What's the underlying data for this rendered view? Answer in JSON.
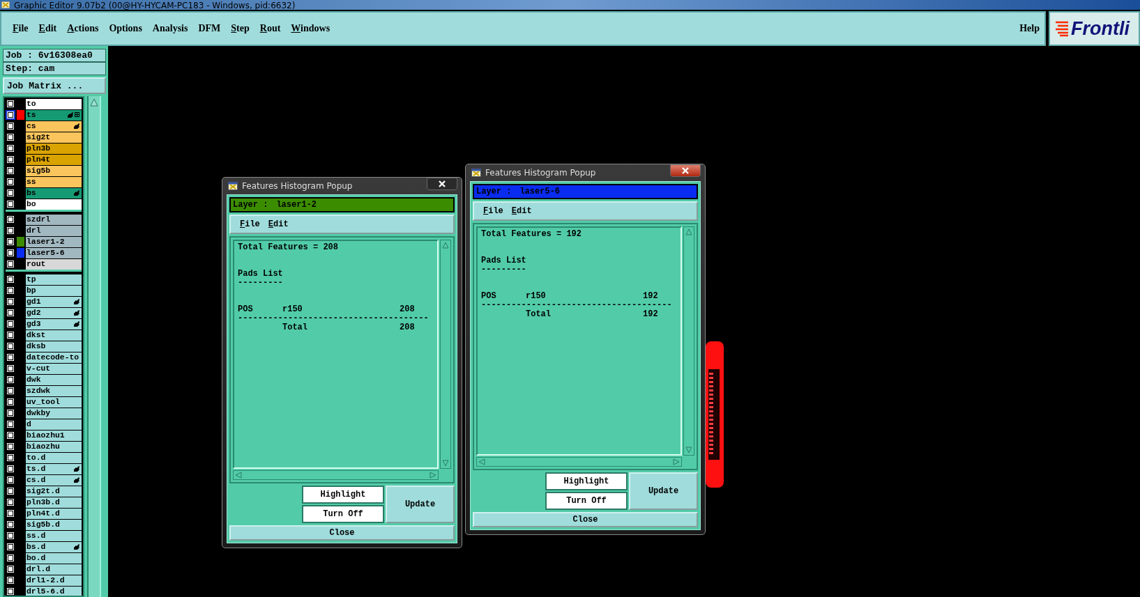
{
  "window": {
    "title": "Graphic Editor 9.07b2 (00@HY-HYCAM-PC183 - Windows, pid:6632)"
  },
  "menu": [
    {
      "label": "File",
      "mnemonic": true
    },
    {
      "label": "Edit",
      "mnemonic": true
    },
    {
      "label": "Actions",
      "mnemonic": true
    },
    {
      "label": "Options",
      "mnemonic": false
    },
    {
      "label": "Analysis",
      "mnemonic": false
    },
    {
      "label": "DFM",
      "mnemonic": false
    },
    {
      "label": "Step",
      "mnemonic": true
    },
    {
      "label": "Rout",
      "mnemonic": true
    },
    {
      "label": "Windows",
      "mnemonic": true
    }
  ],
  "help": "Help",
  "logo": "Frontli",
  "job": "Job : 6v16308ea0",
  "step": "Step: cam",
  "job_matrix": "Job Matrix ...",
  "layer_groups": [
    {
      "layers": [
        {
          "name": "to",
          "color": "#ffffff",
          "selected": false,
          "affected": false
        },
        {
          "name": "ts",
          "color": "#169a74",
          "swatch": {
            "color": "#ff0000"
          },
          "selected": true,
          "affected": true
        },
        {
          "name": "cs",
          "color": "#fac55c",
          "selected": false,
          "affected": true
        },
        {
          "name": "sig2t",
          "color": "#fac55c",
          "selected": false,
          "affected": false
        },
        {
          "name": "pln3b",
          "color": "#d9a300",
          "selected": false,
          "affected": false
        },
        {
          "name": "pln4t",
          "color": "#d9a300",
          "selected": false,
          "affected": false
        },
        {
          "name": "sig5b",
          "color": "#fac55c",
          "selected": false,
          "affected": false
        },
        {
          "name": "ss",
          "color": "#fac55c",
          "selected": false,
          "affected": false
        },
        {
          "name": "bs",
          "color": "#169a74",
          "selected": false,
          "affected": true
        },
        {
          "name": "bo",
          "color": "#ffffff",
          "selected": false,
          "affected": false
        }
      ]
    },
    {
      "layers": [
        {
          "name": "szdrl",
          "color": "#a2b8c0",
          "selected": false,
          "affected": false
        },
        {
          "name": "drl",
          "color": "#a2b8c0",
          "selected": false,
          "affected": false
        },
        {
          "name": "laser1-2",
          "color": "#a2b8c0",
          "swatch": {
            "color": "#3c8c00"
          },
          "selected": false,
          "affected": false
        },
        {
          "name": "laser5-6",
          "color": "#a2b8c0",
          "swatch": {
            "color": "#0a2cf0"
          },
          "selected": false,
          "affected": false
        },
        {
          "name": "rout",
          "color": "#d8d8d8",
          "selected": false,
          "affected": false
        }
      ]
    },
    {
      "layers": [
        {
          "name": "tp",
          "color": "#a0dcdc",
          "selected": false,
          "affected": false
        },
        {
          "name": "bp",
          "color": "#a0dcdc",
          "selected": false,
          "affected": false
        },
        {
          "name": "gd1",
          "color": "#a0dcdc",
          "selected": false,
          "affected": true
        },
        {
          "name": "gd2",
          "color": "#a0dcdc",
          "selected": false,
          "affected": true
        },
        {
          "name": "gd3",
          "color": "#a0dcdc",
          "selected": false,
          "affected": true
        },
        {
          "name": "dkst",
          "color": "#a0dcdc",
          "selected": false,
          "affected": false
        },
        {
          "name": "dksb",
          "color": "#a0dcdc",
          "selected": false,
          "affected": false
        },
        {
          "name": "datecode-to",
          "color": "#a0dcdc",
          "selected": false,
          "affected": false
        },
        {
          "name": "v-cut",
          "color": "#a0dcdc",
          "selected": false,
          "affected": false
        },
        {
          "name": "dwk",
          "color": "#a0dcdc",
          "selected": false,
          "affected": false
        },
        {
          "name": "szdwk",
          "color": "#a0dcdc",
          "selected": false,
          "affected": false
        },
        {
          "name": "uv_tool",
          "color": "#a0dcdc",
          "selected": false,
          "affected": false
        },
        {
          "name": "dwkby",
          "color": "#a0dcdc",
          "selected": false,
          "affected": false
        },
        {
          "name": "d",
          "color": "#a0dcdc",
          "selected": false,
          "affected": false
        },
        {
          "name": "biaozhu1",
          "color": "#a0dcdc",
          "selected": false,
          "affected": false
        },
        {
          "name": "biaozhu",
          "color": "#a0dcdc",
          "selected": false,
          "affected": false
        },
        {
          "name": "to.d",
          "color": "#a0dcdc",
          "selected": false,
          "affected": false
        },
        {
          "name": "ts.d",
          "color": "#a0dcdc",
          "selected": false,
          "affected": true
        },
        {
          "name": "cs.d",
          "color": "#a0dcdc",
          "selected": false,
          "affected": true
        },
        {
          "name": "sig2t.d",
          "color": "#a0dcdc",
          "selected": false,
          "affected": false
        },
        {
          "name": "pln3b.d",
          "color": "#a0dcdc",
          "selected": false,
          "affected": false
        },
        {
          "name": "pln4t.d",
          "color": "#a0dcdc",
          "selected": false,
          "affected": false
        },
        {
          "name": "sig5b.d",
          "color": "#a0dcdc",
          "selected": false,
          "affected": false
        },
        {
          "name": "ss.d",
          "color": "#a0dcdc",
          "selected": false,
          "affected": false
        },
        {
          "name": "bs.d",
          "color": "#a0dcdc",
          "selected": false,
          "affected": true
        },
        {
          "name": "bo.d",
          "color": "#a0dcdc",
          "selected": false,
          "affected": false
        },
        {
          "name": "drl.d",
          "color": "#a0dcdc",
          "selected": false,
          "affected": false
        },
        {
          "name": "drl1-2.d",
          "color": "#a0dcdc",
          "selected": false,
          "affected": false
        },
        {
          "name": "drl5-6.d",
          "color": "#a0dcdc",
          "selected": false,
          "affected": false
        }
      ]
    }
  ],
  "popups": [
    {
      "title": "Features Histogram Popup",
      "active": false,
      "layer_bar": {
        "label": "Layer :",
        "layer": "laser1-2",
        "color": "#3c8c00"
      },
      "menu": [
        "File",
        "Edit"
      ],
      "total": "Total Features = 208",
      "heading": "Pads List",
      "underline": "---------",
      "rows": [
        {
          "type": "POS",
          "symbol": "r150",
          "count": "208"
        }
      ],
      "rule": "--------------------------------------",
      "total_label": "Total",
      "total_count": "208",
      "buttons": {
        "highlight": "Highlight",
        "turn_off": "Turn Off",
        "update": "Update",
        "close": "Close"
      }
    },
    {
      "title": "Features Histogram Popup",
      "active": true,
      "layer_bar": {
        "label": "Layer :",
        "layer": "laser5-6",
        "color": "#0a2cf0"
      },
      "menu": [
        "File",
        "Edit"
      ],
      "total": "Total Features = 192",
      "heading": "Pads List",
      "underline": "---------",
      "rows": [
        {
          "type": "POS",
          "symbol": "r150",
          "count": "192"
        }
      ],
      "rule": "--------------------------------------",
      "total_label": "Total",
      "total_count": "192",
      "buttons": {
        "highlight": "Highlight",
        "turn_off": "Turn Off",
        "update": "Update",
        "close": "Close"
      }
    }
  ]
}
